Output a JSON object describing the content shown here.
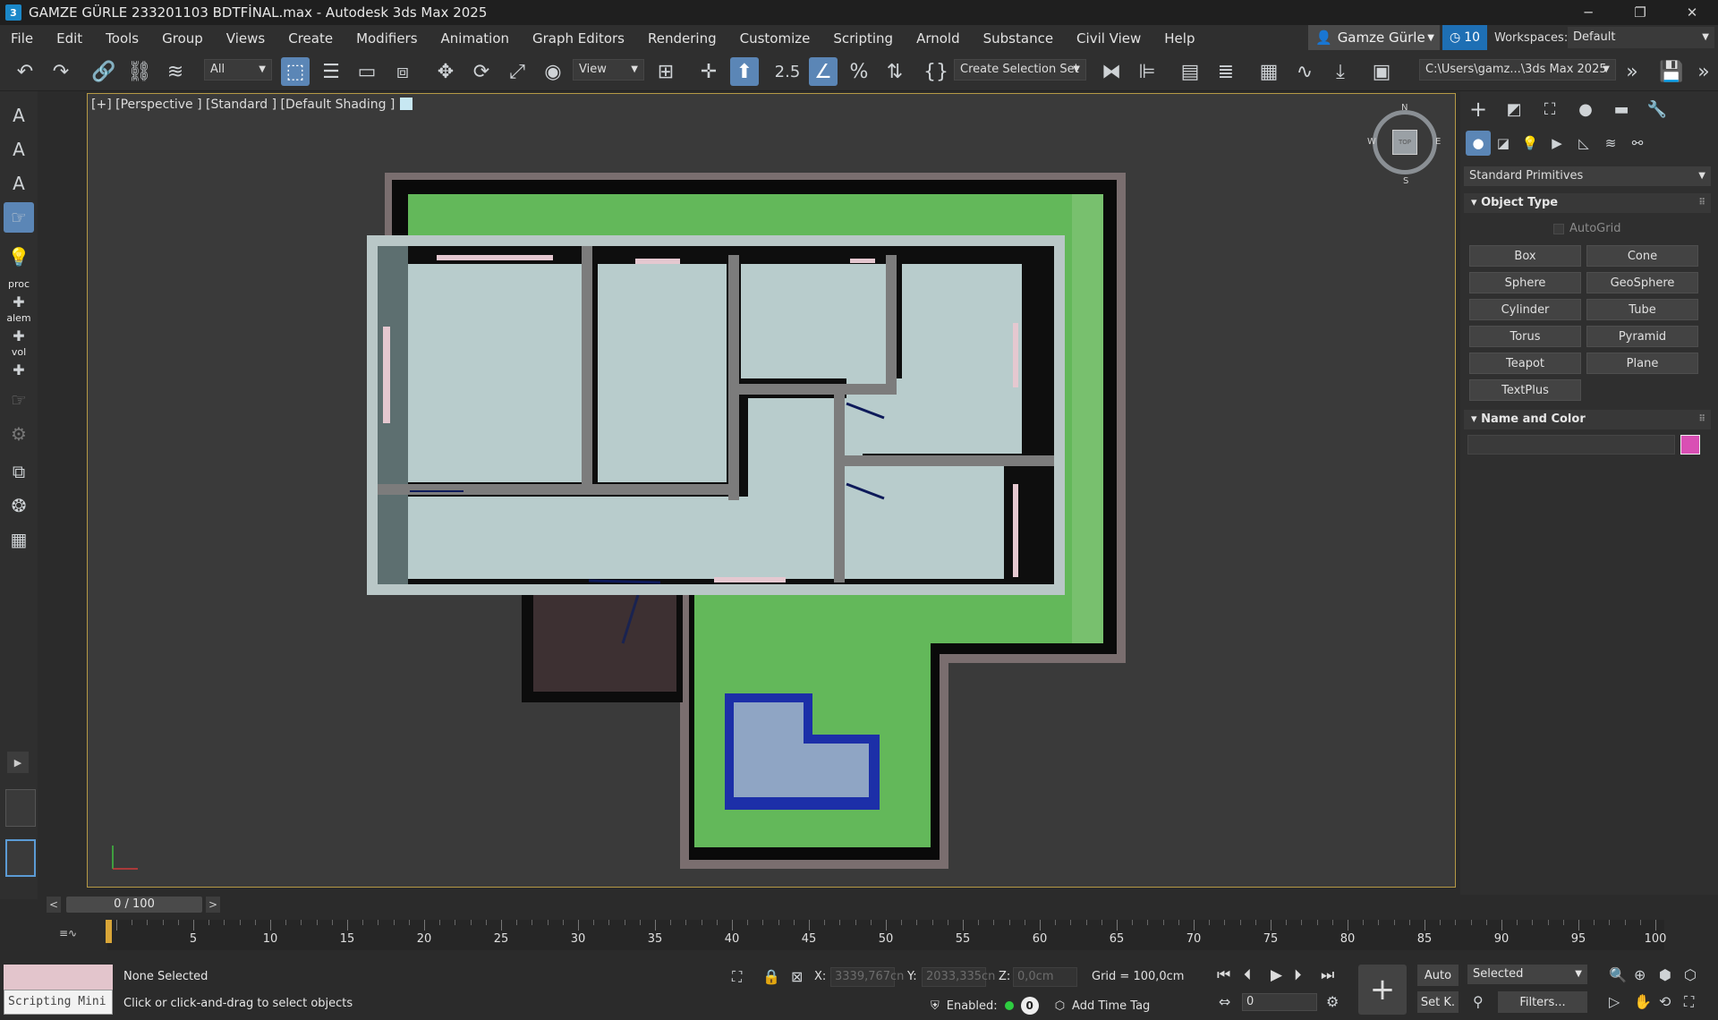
{
  "app": {
    "title": "GAMZE GÜRLE 233201103 BDTFİNAL.max - Autodesk 3ds Max 2025",
    "icon_letter": "3"
  },
  "menu": [
    "File",
    "Edit",
    "Tools",
    "Group",
    "Views",
    "Create",
    "Modifiers",
    "Animation",
    "Graph Editors",
    "Rendering",
    "Customize",
    "Scripting",
    "Arnold",
    "Substance",
    "Civil View",
    "Help"
  ],
  "account": {
    "user": "Gamze Gürle",
    "notifications": "10",
    "workspaces_label": "Workspaces:",
    "workspace": "Default"
  },
  "toolbar": {
    "selection_filter": "All",
    "ref_coord": "View",
    "create_selection_set": "Create Selection Set",
    "snap_label": "2.5",
    "project_path": "C:\\Users\\gamz...\\3ds Max 2025"
  },
  "left_strip": {
    "labels": [
      "proc",
      "alem",
      "vol"
    ]
  },
  "viewport": {
    "label": "[+] [Perspective ] [Standard ] [Default Shading ]",
    "compass": {
      "n": "N",
      "s": "S",
      "e": "E",
      "w": "W",
      "top": "TOP"
    }
  },
  "command_panel": {
    "category": "Standard Primitives",
    "object_type_title": "Object Type",
    "autogrid": "AutoGrid",
    "primitives": [
      "Box",
      "Cone",
      "Sphere",
      "GeoSphere",
      "Cylinder",
      "Tube",
      "Torus",
      "Pyramid",
      "Teapot",
      "Plane",
      "TextPlus"
    ],
    "name_color_title": "Name and Color",
    "object_color": "#d94fb4"
  },
  "timeline": {
    "position": "0 / 100",
    "ticks": [
      "0",
      "5",
      "10",
      "15",
      "20",
      "25",
      "30",
      "35",
      "40",
      "45",
      "50",
      "55",
      "60",
      "65",
      "70",
      "75",
      "80",
      "85",
      "90",
      "95",
      "100"
    ]
  },
  "status": {
    "selection": "None Selected",
    "prompt": "Click or click-and-drag to select objects",
    "script_mini": "Scripting Mini",
    "x_label": "X:",
    "x_value": "3339,767cn",
    "y_label": "Y:",
    "y_value": "2033,335cn",
    "z_label": "Z:",
    "z_value": "0,0cm",
    "grid": "Grid = 100,0cm",
    "enabled": "Enabled:",
    "badge": "0",
    "add_time_tag": "Add Time Tag",
    "frame": "0",
    "auto": "Auto",
    "setk": "Set K.",
    "selected": "Selected",
    "filters": "Filters..."
  }
}
